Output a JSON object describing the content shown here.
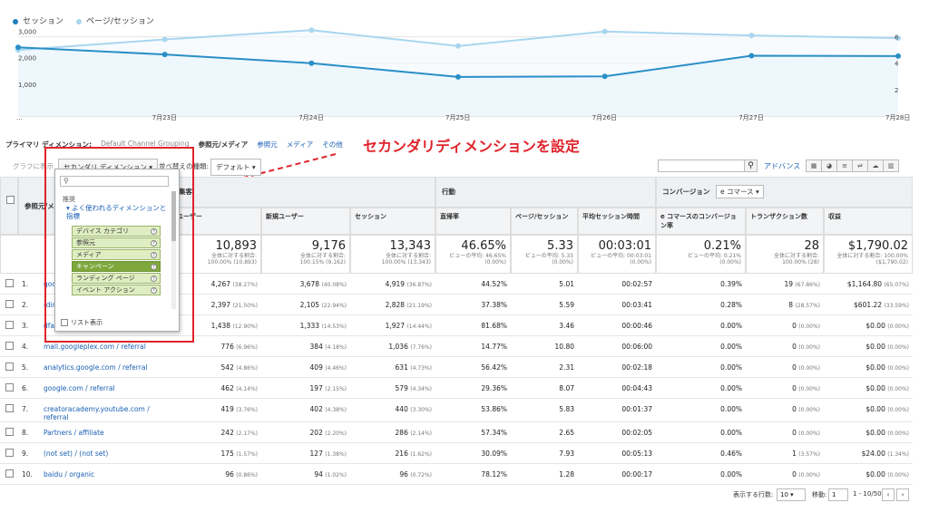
{
  "legend": {
    "series1": "セッション",
    "series2": "ページ/セッション"
  },
  "chart_data": {
    "type": "line",
    "x": [
      "…",
      "7月23日",
      "7月24日",
      "7月25日",
      "7月26日",
      "7月27日",
      "7月28日"
    ],
    "series": [
      {
        "name": "セッション",
        "values": [
          2600,
          2330,
          2000,
          1480,
          1500,
          2280,
          2270
        ]
      },
      {
        "name": "ページ/セッション",
        "values": [
          5.0,
          5.8,
          6.5,
          5.3,
          6.4,
          6.1,
          5.9
        ]
      }
    ],
    "y_left_ticks": [
      "3,000",
      "2,000",
      "1,000"
    ],
    "y_right_ticks": [
      "6",
      "4",
      "2"
    ],
    "colors": {
      "sessions": "#2a8fc7",
      "pages": "#a9d6ef"
    }
  },
  "dimension_bar": {
    "primary_label": "プライマリ ディメンション:",
    "items": [
      "Default Channel Grouping",
      "参照元/メディア",
      "参照元",
      "メディア",
      "その他"
    ]
  },
  "annotation": "セカンダリディメンションを設定",
  "toolbar": {
    "graph": "グラフに表示",
    "secondary": "セカンダリ ディメンション ▾",
    "sort_label": "並べ替えの種類:",
    "sort_value": "デフォルト ▾",
    "advanced": "アドバンス"
  },
  "groups": {
    "acquisition": "集客",
    "behavior": "行動",
    "conversion": "コンバージョン",
    "conversion_select": "e コマース ▾"
  },
  "headers": [
    "ユーザー",
    "新規ユーザー",
    "セッション",
    "直帰率",
    "ページ/セッション",
    "平均セッション時間",
    "e コマースのコンバージョン率",
    "トランザクション数",
    "収益"
  ],
  "source_header": "参照元/メディア",
  "totals": [
    {
      "big": "10,893",
      "s1": "全体に対する割合:",
      "s2": "100.00% (10,893)"
    },
    {
      "big": "9,176",
      "s1": "全体に対する割合:",
      "s2": "100.15% (9,162)"
    },
    {
      "big": "13,343",
      "s1": "全体に対する割合:",
      "s2": "100.00% (13,343)"
    },
    {
      "big": "46.65%",
      "s1": "ビューの平均: 46.65%",
      "s2": "(0.00%)"
    },
    {
      "big": "5.33",
      "s1": "ビューの平均: 5.33",
      "s2": "(0.00%)"
    },
    {
      "big": "00:03:01",
      "s1": "ビューの平均: 00:03:01",
      "s2": "(0.00%)"
    },
    {
      "big": "0.21%",
      "s1": "ビューの平均: 0.21%",
      "s2": "(0.00%)"
    },
    {
      "big": "28",
      "s1": "全体に対する割合:",
      "s2": "100.00% (28)"
    },
    {
      "big": "$1,790.02",
      "s1": "全体に対する割合: 100.00%",
      "s2": "($1,790.02)"
    }
  ],
  "rows": [
    {
      "n": "1.",
      "src": "goo…",
      "u": "4,267",
      "up": "(38.27%)",
      "nu": "3,678",
      "nup": "(40.08%)",
      "s": "4,919",
      "sp": "(36.87%)",
      "b": "44.52%",
      "pps": "5.01",
      "t": "00:02:57",
      "cr": "0.39%",
      "tr": "19",
      "trp": "(67.86%)",
      "rev": "$1,164.80",
      "revp": "(65.07%)"
    },
    {
      "n": "2.",
      "src": "(dire…",
      "u": "2,397",
      "up": "(21.50%)",
      "nu": "2,105",
      "nup": "(22.94%)",
      "s": "2,828",
      "sp": "(21.19%)",
      "b": "37.38%",
      "pps": "5.59",
      "t": "00:03:41",
      "cr": "0.28%",
      "tr": "8",
      "trp": "(28.57%)",
      "rev": "$601.22",
      "revp": "(33.59%)"
    },
    {
      "n": "3.",
      "src": "dfa…",
      "u": "1,438",
      "up": "(12.90%)",
      "nu": "1,333",
      "nup": "(14.53%)",
      "s": "1,927",
      "sp": "(14.44%)",
      "b": "81.68%",
      "pps": "3.46",
      "t": "00:00:46",
      "cr": "0.00%",
      "tr": "0",
      "trp": "(0.00%)",
      "rev": "$0.00",
      "revp": "(0.00%)"
    },
    {
      "n": "4.",
      "src": "mall.googleplex.com / referral",
      "u": "776",
      "up": "(6.96%)",
      "nu": "384",
      "nup": "(4.18%)",
      "s": "1,036",
      "sp": "(7.76%)",
      "b": "14.77%",
      "pps": "10.80",
      "t": "00:06:00",
      "cr": "0.00%",
      "tr": "0",
      "trp": "(0.00%)",
      "rev": "$0.00",
      "revp": "(0.00%)"
    },
    {
      "n": "5.",
      "src": "analytics.google.com / referral",
      "u": "542",
      "up": "(4.86%)",
      "nu": "409",
      "nup": "(4.46%)",
      "s": "631",
      "sp": "(4.73%)",
      "b": "56.42%",
      "pps": "2.31",
      "t": "00:02:18",
      "cr": "0.00%",
      "tr": "0",
      "trp": "(0.00%)",
      "rev": "$0.00",
      "revp": "(0.00%)"
    },
    {
      "n": "6.",
      "src": "google.com / referral",
      "u": "462",
      "up": "(4.14%)",
      "nu": "197",
      "nup": "(2.15%)",
      "s": "579",
      "sp": "(4.34%)",
      "b": "29.36%",
      "pps": "8.07",
      "t": "00:04:43",
      "cr": "0.00%",
      "tr": "0",
      "trp": "(0.00%)",
      "rev": "$0.00",
      "revp": "(0.00%)"
    },
    {
      "n": "7.",
      "src": "creatoracademy.youtube.com / referral",
      "u": "419",
      "up": "(3.76%)",
      "nu": "402",
      "nup": "(4.38%)",
      "s": "440",
      "sp": "(3.30%)",
      "b": "53.86%",
      "pps": "5.83",
      "t": "00:01:37",
      "cr": "0.00%",
      "tr": "0",
      "trp": "(0.00%)",
      "rev": "$0.00",
      "revp": "(0.00%)"
    },
    {
      "n": "8.",
      "src": "Partners / affiliate",
      "u": "242",
      "up": "(2.17%)",
      "nu": "202",
      "nup": "(2.20%)",
      "s": "286",
      "sp": "(2.14%)",
      "b": "57.34%",
      "pps": "2.65",
      "t": "00:02:05",
      "cr": "0.00%",
      "tr": "0",
      "trp": "(0.00%)",
      "rev": "$0.00",
      "revp": "(0.00%)"
    },
    {
      "n": "9.",
      "src": "(not set) / (not set)",
      "u": "175",
      "up": "(1.57%)",
      "nu": "127",
      "nup": "(1.38%)",
      "s": "216",
      "sp": "(1.62%)",
      "b": "30.09%",
      "pps": "7.93",
      "t": "00:05:13",
      "cr": "0.46%",
      "tr": "1",
      "trp": "(3.57%)",
      "rev": "$24.00",
      "revp": "(1.34%)"
    },
    {
      "n": "10.",
      "src": "baidu / organic",
      "u": "96",
      "up": "(0.86%)",
      "nu": "94",
      "nup": "(1.02%)",
      "s": "96",
      "sp": "(0.72%)",
      "b": "78.12%",
      "pps": "1.28",
      "t": "00:00:17",
      "cr": "0.00%",
      "tr": "0",
      "trp": "(0.00%)",
      "rev": "$0.00",
      "revp": "(0.00%)"
    }
  ],
  "dropdown": {
    "caption": "推奨",
    "group": "▾ よく使われるディメンションと指標",
    "options": [
      "デバイス カテゴリ",
      "参照元",
      "メディア",
      "キャンペーン",
      "ランディング ページ",
      "イベント アクション"
    ],
    "selected_index": 3,
    "list_view": "リスト表示"
  },
  "pager": {
    "rows_label": "表示する行数:",
    "rows_value": "10 ▾",
    "goto_label": "移動:",
    "goto_value": "1",
    "range": "1 - 10/50"
  }
}
